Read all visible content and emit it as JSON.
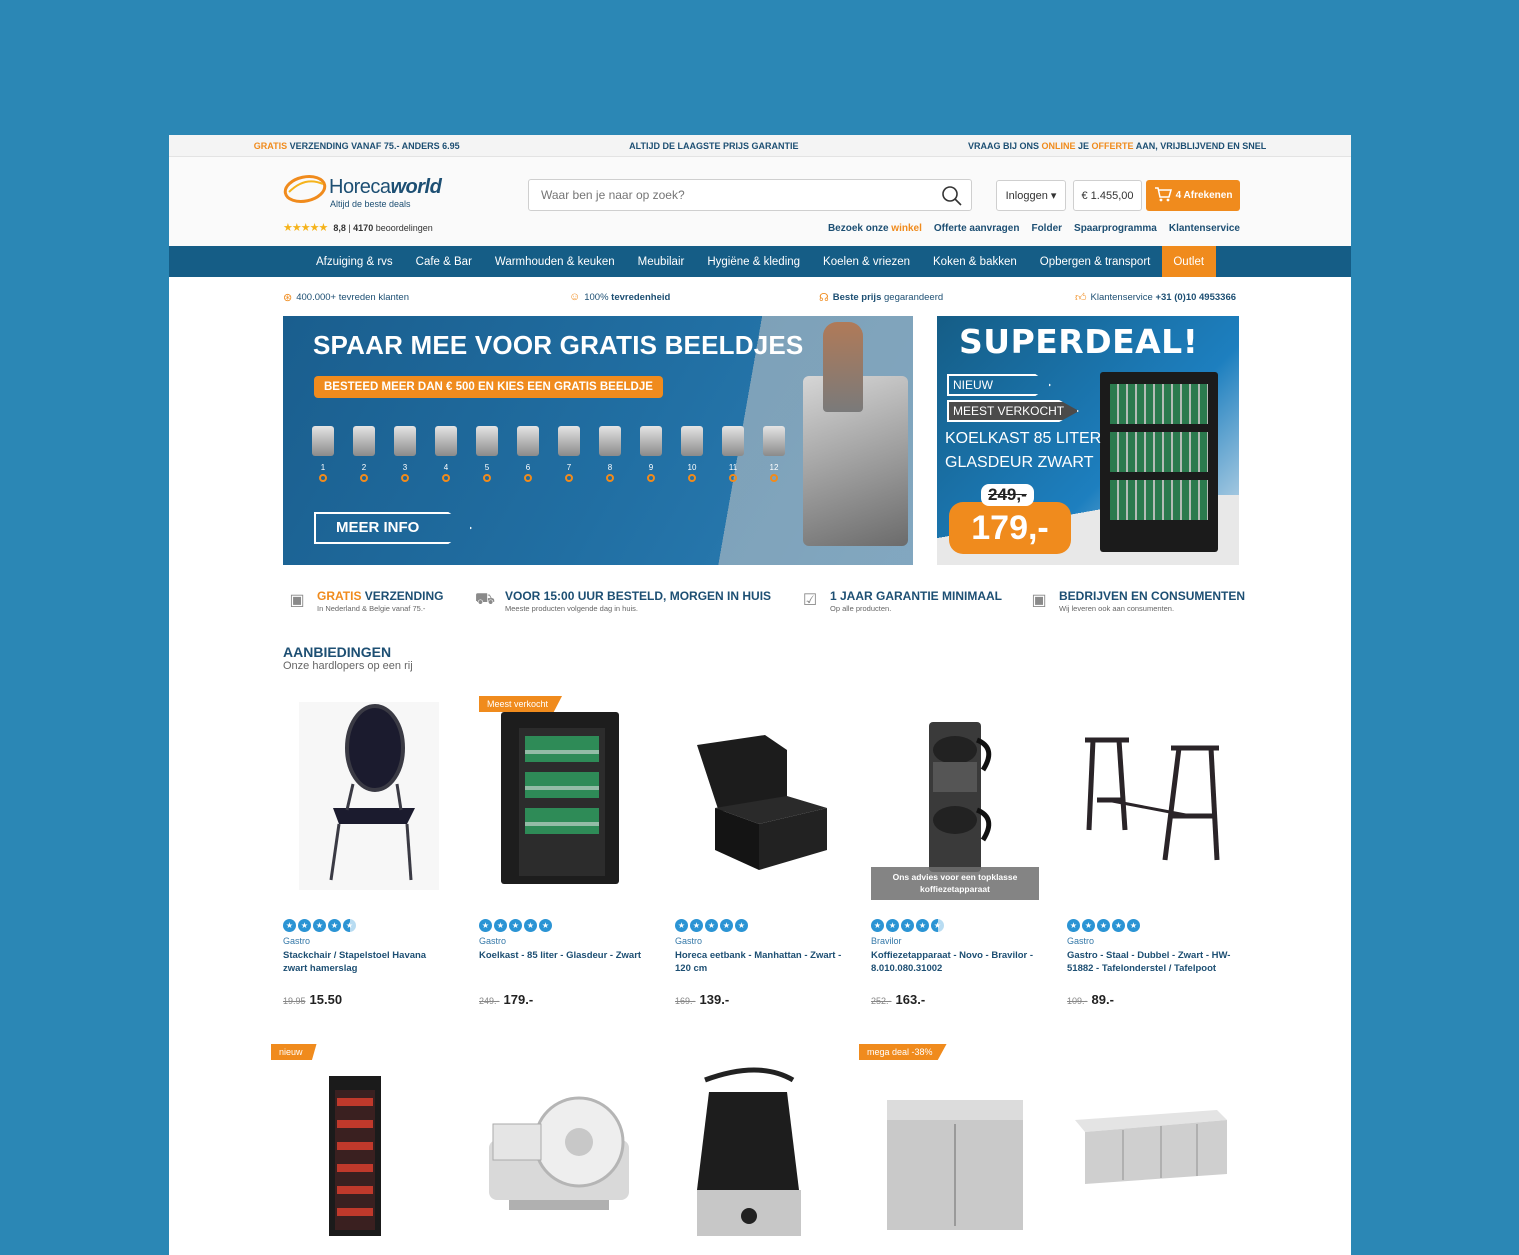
{
  "topbar": {
    "usp1_orange": "GRATIS",
    "usp1_rest": " VERZENDING VANAF 75.- ANDERS 6.95",
    "usp2": "ALTIJD DE LAAGSTE PRIJS GARANTIE",
    "usp3_a": "VRAAG BIJ ONS ",
    "usp3_b": "ONLINE",
    "usp3_c": " JE ",
    "usp3_d": "OFFERTE",
    "usp3_e": " AAN, VRIJBLIJVEND EN SNEL"
  },
  "header": {
    "logo_light": "Horeca",
    "logo_bold": "world",
    "tagline": "Altijd de beste deals",
    "rating_stars": "★★★★★",
    "rating_score": "8,8",
    "rating_sep": " | ",
    "rating_count": "4170",
    "rating_label": " beoordelingen",
    "search_placeholder": "Waar ben je naar op zoek?",
    "login_label": "Inloggen",
    "cart_total": "€ 1.455,00",
    "cart_label": "4 Afrekenen",
    "links": {
      "visit_a": "Bezoek onze ",
      "visit_b": "winkel",
      "quote": "Offerte aanvragen",
      "folder": "Folder",
      "savings": "Spaarprogramma",
      "service": "Klantenservice"
    }
  },
  "nav": {
    "items": [
      "Afzuiging & rvs",
      "Cafe & Bar",
      "Warmhouden & keuken",
      "Meubilair",
      "Hygiëne & kleding",
      "Koelen & vriezen",
      "Koken & bakken",
      "Opbergen & transport",
      "Outlet"
    ]
  },
  "usps": {
    "u1_bold": "400.000+ tevreden",
    "u1_rest": " klanten",
    "u2_rest": "100% ",
    "u2_bold": "tevredenheid",
    "u3_bold": "Beste prijs",
    "u3_rest": " gegarandeerd",
    "u4_rest": "Klantenservice ",
    "u4_bold": "+31 (0)10 4953366"
  },
  "banner": {
    "title": "SPAAR MEE VOOR GRATIS BEELDJES",
    "subtitle": "BESTEED MEER DAN € 500 EN KIES EEN GRATIS BEELDJE",
    "numbers": [
      "1",
      "2",
      "3",
      "4",
      "5",
      "6",
      "7",
      "8",
      "9",
      "10",
      "11",
      "12"
    ],
    "cta": "MEER INFO"
  },
  "superdeal": {
    "title": "SUPERDEAL!",
    "tag_new": "NIEUW",
    "tag_best": "MEEST VERKOCHT",
    "desc1": "KOELKAST 85 LITER",
    "desc2": "GLASDEUR ZWART",
    "old_price": "249,-",
    "new_price": "179,-"
  },
  "benefits": [
    {
      "title_orange": "GRATIS",
      "title_rest": " VERZENDING",
      "sub": "In Nederland & Belgie vanaf 75.-"
    },
    {
      "title_orange": "",
      "title_rest": "VOOR 15:00 UUR BESTELD, MORGEN IN HUIS",
      "sub": "Meeste producten volgende dag in huis."
    },
    {
      "title_orange": "",
      "title_rest": "1 JAAR GARANTIE MINIMAAL",
      "sub": "Op alle producten."
    },
    {
      "title_orange": "",
      "title_rest": "BEDRIJVEN EN CONSUMENTEN",
      "sub": "Wij leveren ook aan consumenten."
    }
  ],
  "offers": {
    "title": "AANBIEDINGEN",
    "subtitle": "Onze hardlopers op een rij",
    "products": [
      {
        "brand": "Gastro",
        "title": "Stackchair / Stapelstoel Havana zwart hamerslag",
        "old": "19.95",
        "price": "15.50",
        "stars": 4.5,
        "badge": ""
      },
      {
        "brand": "Gastro",
        "title": "Koelkast - 85 liter - Glasdeur - Zwart",
        "old": "249.-",
        "price": "179.-",
        "stars": 5,
        "badge": "Meest verkocht"
      },
      {
        "brand": "Gastro",
        "title": "Horeca eetbank - Manhattan - Zwart - 120 cm",
        "old": "169.-",
        "price": "139.-",
        "stars": 5,
        "badge": ""
      },
      {
        "brand": "Bravilor",
        "title": "Koffiezetapparaat - Novo - Bravilor - 8.010.080.31002",
        "old": "252.-",
        "price": "163.-",
        "stars": 4.5,
        "badge": "",
        "advice": "Ons advies voor een topklasse koffiezetapparaat"
      },
      {
        "brand": "Gastro",
        "title": "Gastro - Staal - Dubbel - Zwart - HW-51882 - Tafelonderstel / Tafelpoot",
        "old": "109.-",
        "price": "89.-",
        "stars": 5,
        "badge": ""
      }
    ],
    "row2_badges": [
      "nieuw",
      "",
      "",
      "mega deal -38%",
      ""
    ]
  },
  "colors": {
    "accent": "#f08b1d",
    "brand": "#1d4f73",
    "nav": "#155d86",
    "background": "#2b87b5"
  }
}
